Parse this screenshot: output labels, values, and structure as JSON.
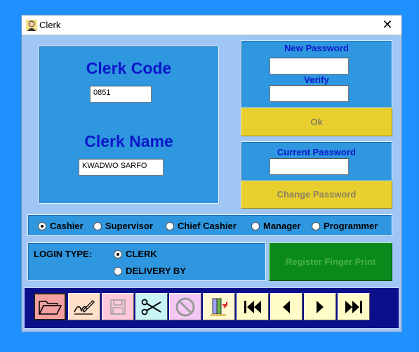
{
  "window": {
    "title": "Clerk",
    "close_glyph": "✕"
  },
  "clerk": {
    "code_label": "Clerk Code",
    "code_value": "0851",
    "name_label": "Clerk Name",
    "name_value": "KWADWO SARFO"
  },
  "password": {
    "new_label": "New Password",
    "new_value": "",
    "verify_label": "Verify",
    "verify_value": "",
    "ok_label": "Ok",
    "current_label": "Current Password",
    "current_value": "",
    "change_label": "Change Password"
  },
  "roles": {
    "selected": "Cashier",
    "options": [
      "Cashier",
      "Supervisor",
      "Chief Cashier",
      "Manager",
      "Programmer"
    ]
  },
  "login": {
    "label": "LOGIN TYPE:",
    "selected": "CLERK",
    "options": [
      "CLERK",
      "DELIVERY BY"
    ]
  },
  "finger_print_label": "Register Finger Print",
  "toolbar": {
    "buttons": [
      {
        "icon": "folder-open-icon",
        "bg": "#f4a0a0"
      },
      {
        "icon": "signature-icon",
        "bg": "#ffe0c8"
      },
      {
        "icon": "save-icon",
        "bg": "#ffc8d8"
      },
      {
        "icon": "scissors-icon",
        "bg": "#c8f4f4"
      },
      {
        "icon": "cancel-icon",
        "bg": "#f4c8f4"
      },
      {
        "icon": "exit-door-icon",
        "bg": "#fff8d0"
      },
      {
        "icon": "first-record-icon",
        "bg": "#fffcc8"
      },
      {
        "icon": "previous-record-icon",
        "bg": "#fffcc8"
      },
      {
        "icon": "next-record-icon",
        "bg": "#fffcc8"
      },
      {
        "icon": "last-record-icon",
        "bg": "#fffcc8"
      }
    ]
  },
  "colors": {
    "background": "#1e90ff",
    "form": "#9fc6f5",
    "panel": "#2f97e0",
    "label_blue": "#0b18c9",
    "yellow_button": "#e8cf2e",
    "green_button": "#0b8a1c",
    "toolbar": "#0b0f8a"
  }
}
